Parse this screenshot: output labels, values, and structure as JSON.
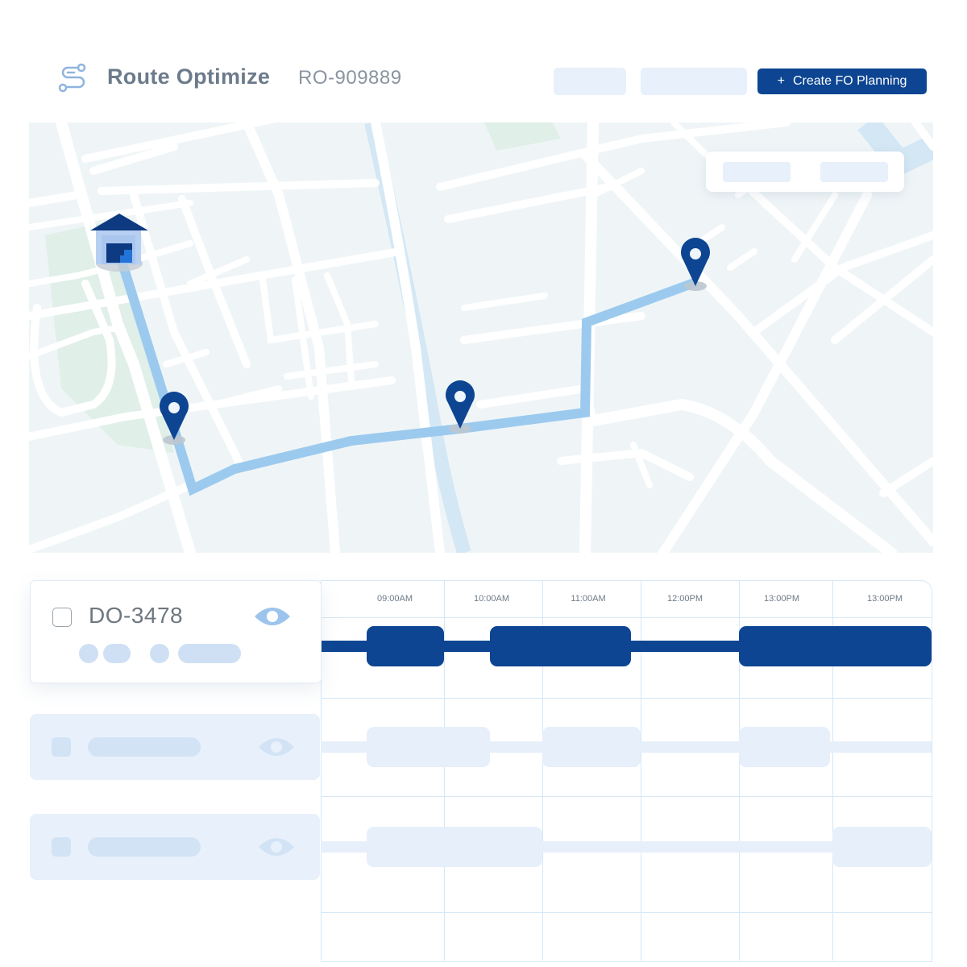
{
  "header": {
    "icon": "route-icon",
    "title": "Route Optimize",
    "route_id": "RO-909889",
    "placeholder_buttons": 2,
    "create_button": {
      "icon": "plus-icon",
      "icon_glyph": "+",
      "label": "Create FO Planning"
    }
  },
  "colors": {
    "primary": "#0d4592",
    "route_line": "#9ccaee",
    "placeholder": "#e8f0fb",
    "map_bg": "#eff5f7",
    "river": "#d4e7f4",
    "park": "#e0efe8",
    "grid": "#d5e8f7",
    "ghost_segment": "#e6effa"
  },
  "map": {
    "warehouse_icon": "warehouse-icon",
    "stops": [
      {
        "name": "stop-1",
        "icon": "map-pin-icon"
      },
      {
        "name": "stop-2",
        "icon": "map-pin-icon"
      },
      {
        "name": "stop-3",
        "icon": "map-pin-icon"
      }
    ],
    "overlay_placeholders": 2
  },
  "orders": [
    {
      "id": "DO-3478",
      "selected": false,
      "active": true,
      "eye_icon": "eye-icon"
    },
    {
      "id": "",
      "active": false,
      "eye_icon": "eye-icon"
    },
    {
      "id": "",
      "active": false,
      "eye_icon": "eye-icon"
    }
  ],
  "timeline": {
    "hours": [
      "09:00AM",
      "10:00AM",
      "11:00AM",
      "12:00PM",
      "13:00PM",
      "13:00PM"
    ],
    "lanes": [
      {
        "order": "DO-3478",
        "active": true,
        "segments": [
          {
            "start": 0.37,
            "end": 1.0
          },
          {
            "start": 1.47,
            "end": 2.9
          },
          {
            "start": 4.0,
            "end": 6.0
          }
        ]
      },
      {
        "order": "placeholder-2",
        "active": false,
        "segments": [
          {
            "start": 0.37,
            "end": 1.47
          },
          {
            "start": 2.0,
            "end": 3.0
          },
          {
            "start": 4.0,
            "end": 4.97
          }
        ]
      },
      {
        "order": "placeholder-3",
        "active": false,
        "segments": [
          {
            "start": 0.37,
            "end": 2.0
          },
          {
            "start": 5.0,
            "end": 6.0
          }
        ]
      }
    ]
  }
}
